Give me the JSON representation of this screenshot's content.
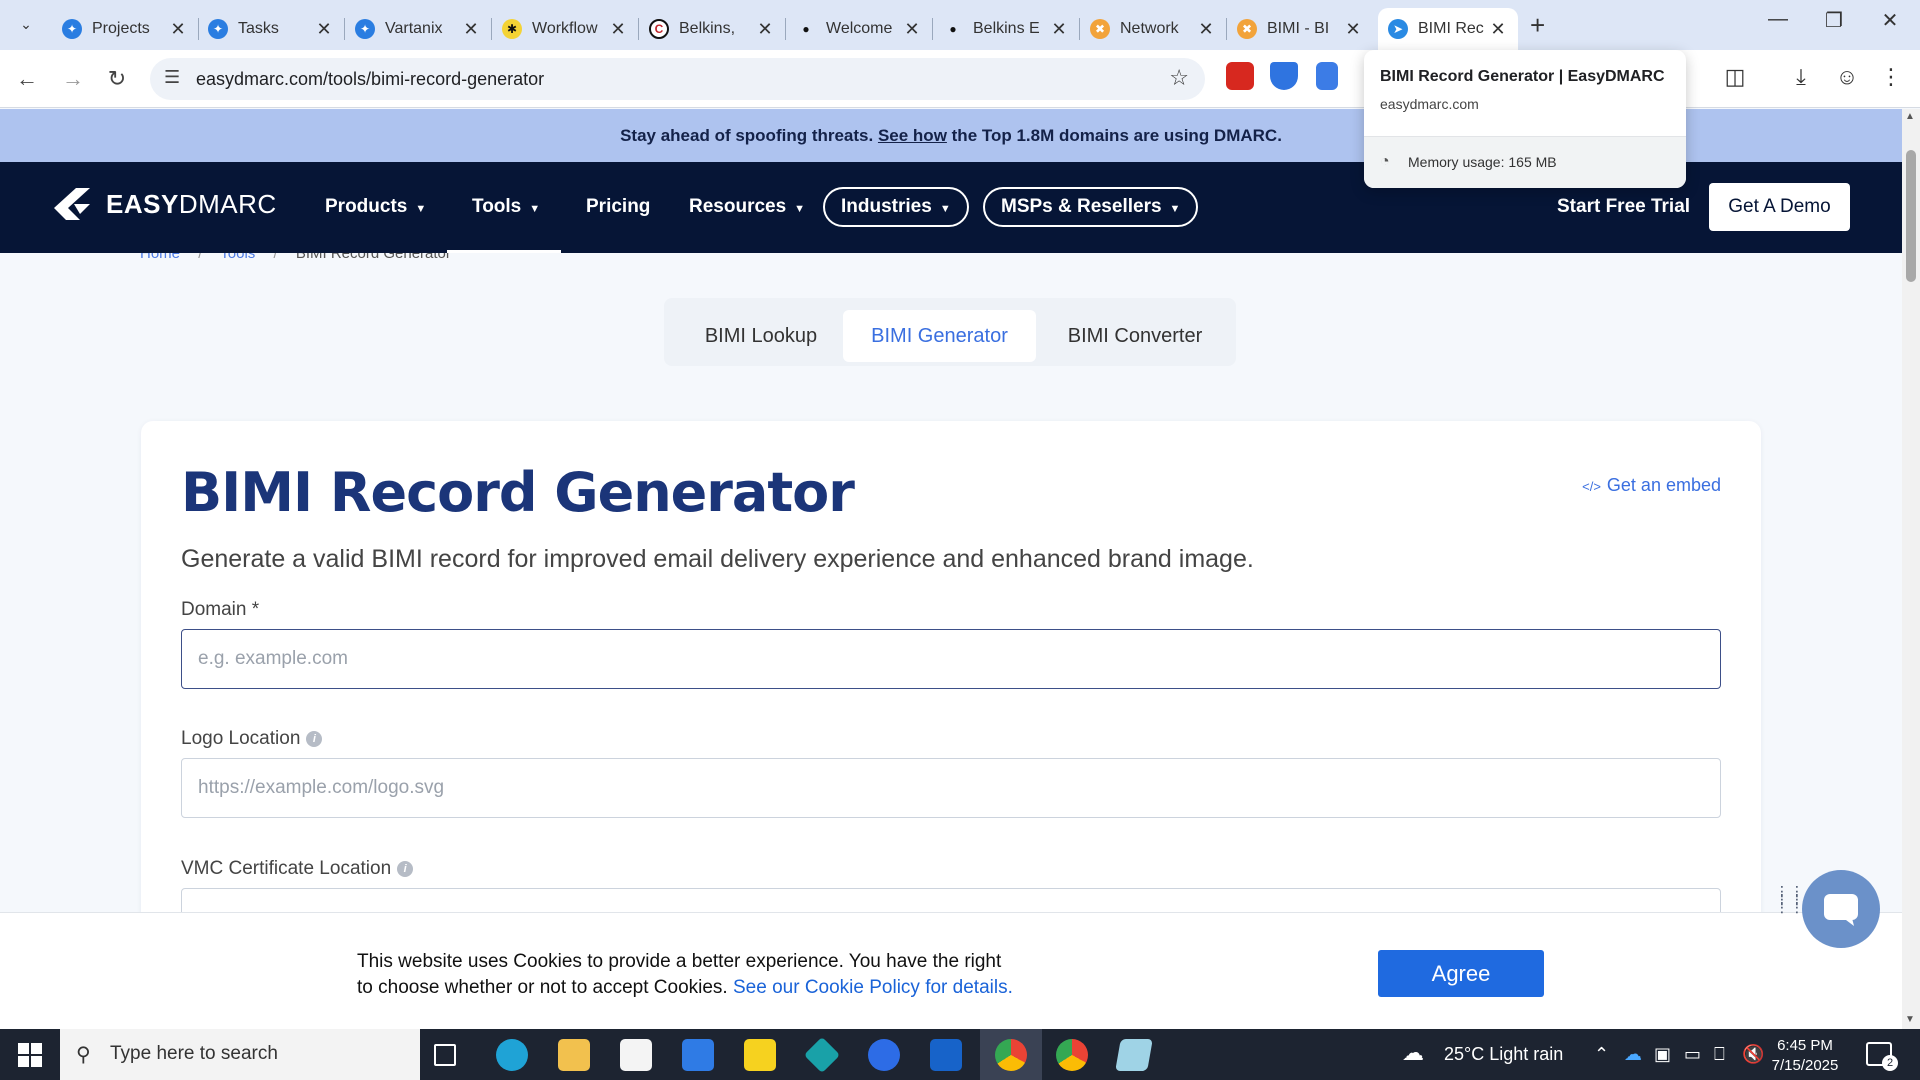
{
  "browser": {
    "tabs": [
      {
        "title": "Projects",
        "favicon_color": "#2a7de1"
      },
      {
        "title": "Tasks",
        "favicon_color": "#2a7de1"
      },
      {
        "title": "Vartanix",
        "favicon_color": "#2a7de1"
      },
      {
        "title": "Workflow",
        "favicon_color": "#111111"
      },
      {
        "title": "Belkins,",
        "favicon_color": "#111111"
      },
      {
        "title": "Welcome",
        "favicon_color": "#111111"
      },
      {
        "title": "Belkins E",
        "favicon_color": "#111111"
      },
      {
        "title": "Network",
        "favicon_color": "#f2a33a"
      },
      {
        "title": "BIMI - BI",
        "favicon_color": "#f2a33a"
      },
      {
        "title": "BIMI Rec",
        "favicon_color": "#2a8ae3",
        "active": true
      }
    ],
    "url": "easydmarc.com/tools/bimi-record-generator",
    "hover_card": {
      "title": "BIMI Record Generator | EasyDMARC",
      "domain": "easydmarc.com",
      "memory": "Memory usage: 165 MB"
    }
  },
  "banner": {
    "prefix": "Stay ahead of spoofing threats. ",
    "link": "See how",
    "suffix": " the Top 1.8M domains are using DMARC."
  },
  "sitenav": {
    "logo_bold": "EASY",
    "logo_light": "DMARC",
    "items": [
      "Products",
      "Tools",
      "Pricing",
      "Resources"
    ],
    "pills": [
      "Industries",
      "MSPs & Resellers"
    ],
    "start_trial": "Start Free Trial",
    "demo": "Get A Demo"
  },
  "breadcrumb": {
    "home": "Home",
    "tools": "Tools",
    "current": "BIMI Record Generator",
    "sep": "/"
  },
  "tool_tabs": [
    "BIMI Lookup",
    "BIMI Generator",
    "BIMI Converter"
  ],
  "card": {
    "title": "BIMI Record Generator",
    "embed": "Get an embed",
    "subtitle": "Generate a valid BIMI record for improved email delivery experience and enhanced brand image.",
    "fields": [
      {
        "label": "Domain *",
        "placeholder": "e.g. example.com",
        "info": false
      },
      {
        "label": "Logo Location",
        "placeholder": "https://example.com/logo.svg",
        "info": true
      },
      {
        "label": "VMC Certificate Location",
        "placeholder": "",
        "info": true
      }
    ]
  },
  "cookie": {
    "text": "This website uses Cookies to provide a better experience. You have the right to choose whether or not to accept Cookies. ",
    "link": "See our Cookie Policy for details.",
    "button": "Agree"
  },
  "taskbar": {
    "search_placeholder": "Type here to search",
    "weather": "25°C  Light rain",
    "time": "6:45 PM",
    "date": "7/15/2025",
    "notifications": "2"
  },
  "colors": {
    "nav_bg": "#061536",
    "banner_bg": "#aec3ef",
    "title": "#1b3579",
    "accent": "#3a6fe0",
    "agree": "#1f6ae0"
  }
}
